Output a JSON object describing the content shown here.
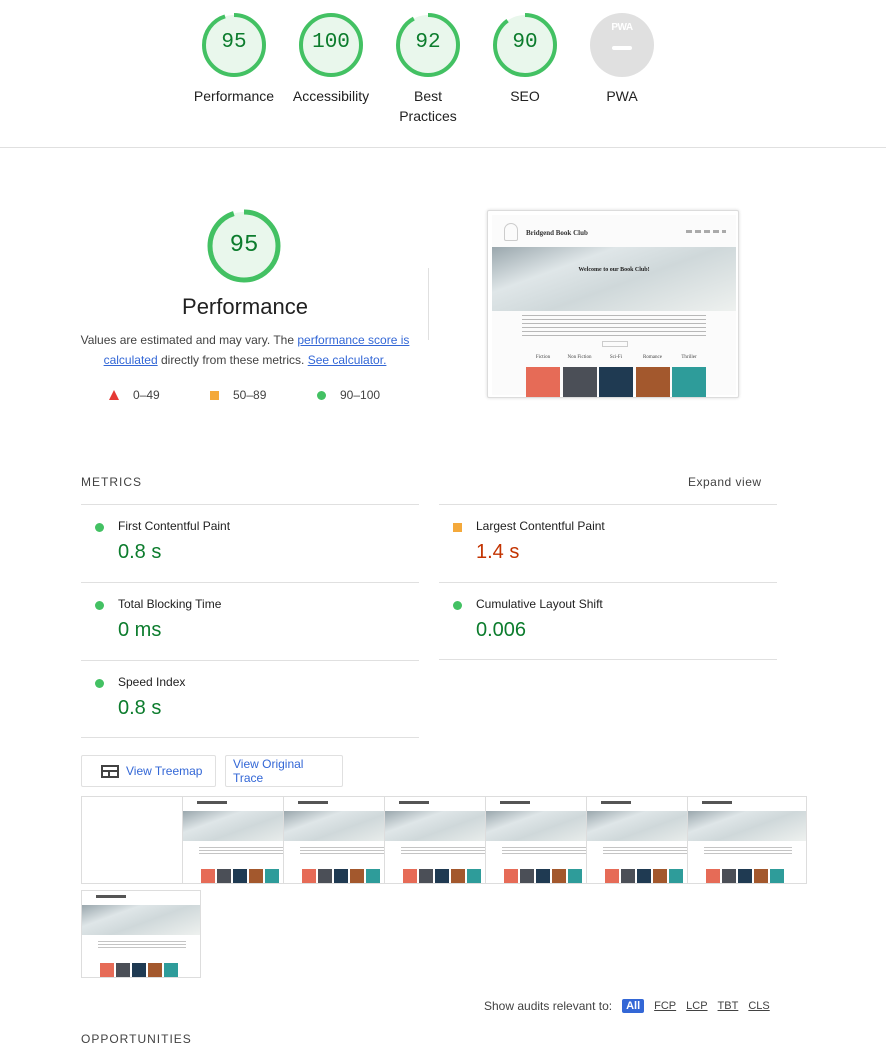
{
  "summary_gauges": [
    {
      "label": "Performance",
      "score": "95",
      "fraction": 0.95
    },
    {
      "label": "Accessibility",
      "score": "100",
      "fraction": 1.0
    },
    {
      "label": "Best Practices",
      "score": "92",
      "fraction": 0.92
    },
    {
      "label": "SEO",
      "score": "90",
      "fraction": 0.9
    },
    {
      "label": "PWA",
      "badge": "PWA",
      "score": ""
    }
  ],
  "performance": {
    "score": "95",
    "fraction": 0.95,
    "title": "Performance",
    "desc_part1": "Values are estimated and may vary. The ",
    "link1": "performance score is calculated",
    "desc_part2": " directly from these metrics. ",
    "link2": "See calculator."
  },
  "legend": {
    "fail": "0–49",
    "average": "50–89",
    "pass": "90–100"
  },
  "screenshot": {
    "brand": "Bridgend Book Club",
    "hero_title": "Welcome to our Book Club!",
    "genres": [
      "Fiction",
      "Non Fiction",
      "Sci-Fi",
      "Romance",
      "Thriller"
    ],
    "cover_colors": [
      "#e66b57",
      "#4b4f57",
      "#1f3a52",
      "#a3582d",
      "#2e9c9a"
    ]
  },
  "metrics": {
    "header": "METRICS",
    "expand": "Expand view",
    "items": [
      {
        "label": "First Contentful Paint",
        "value": "0.8 s",
        "rating": "pass"
      },
      {
        "label": "Largest Contentful Paint",
        "value": "1.4 s",
        "rating": "average"
      },
      {
        "label": "Total Blocking Time",
        "value": "0 ms",
        "rating": "pass"
      },
      {
        "label": "Cumulative Layout Shift",
        "value": "0.006",
        "rating": "pass"
      },
      {
        "label": "Speed Index",
        "value": "0.8 s",
        "rating": "pass"
      }
    ]
  },
  "buttons": {
    "treemap": "View Treemap",
    "trace": "View Original Trace"
  },
  "audits_filter": {
    "label": "Show audits relevant to:",
    "options": [
      "All",
      "FCP",
      "LCP",
      "TBT",
      "CLS"
    ]
  },
  "opportunities": "OPPORTUNITIES",
  "colors": {
    "pass": "#0c7c2d",
    "pass_ring": "#43c163",
    "average": "#c33300",
    "average_mark": "#f4a93b",
    "fail": "#e53935",
    "link": "#3367d6"
  }
}
